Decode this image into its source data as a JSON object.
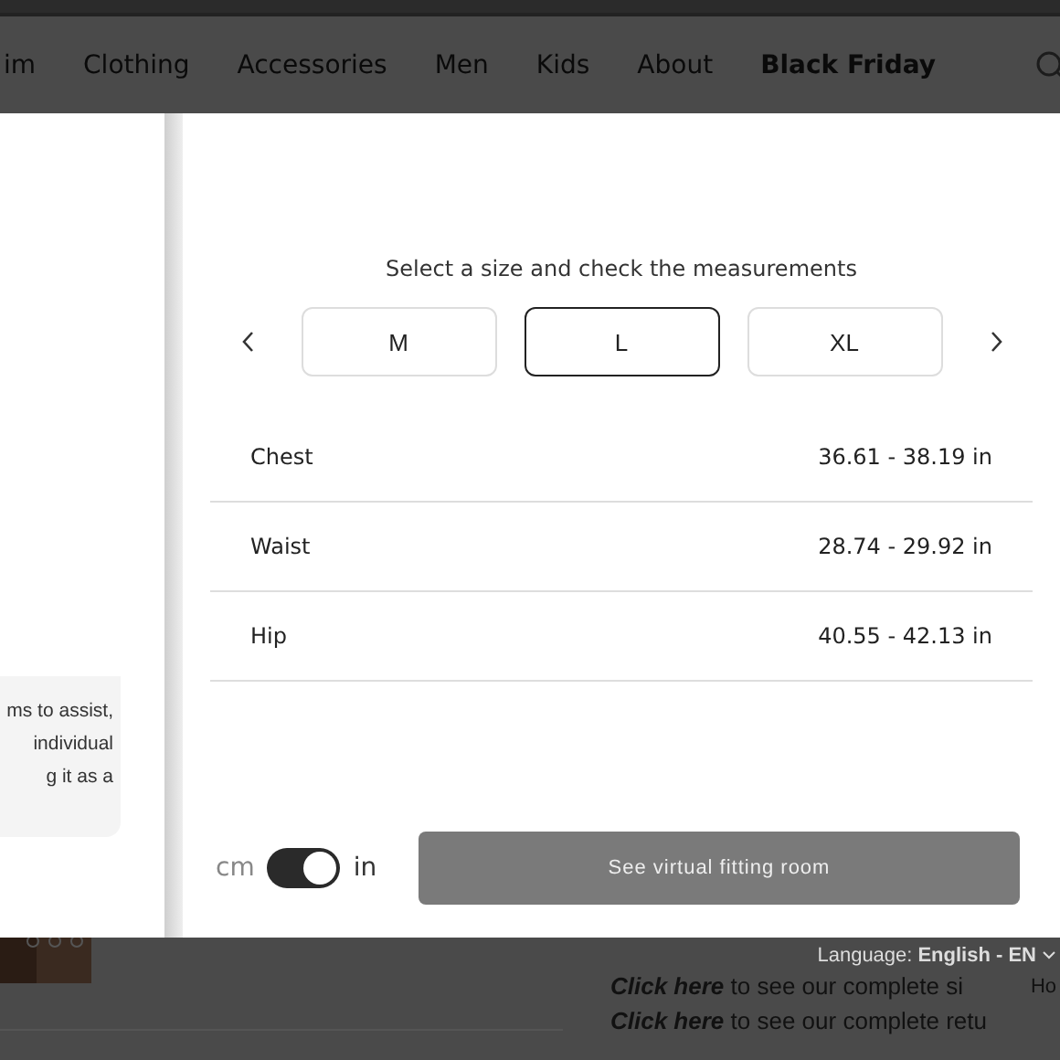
{
  "nav": {
    "items": [
      {
        "label": "im",
        "emphasized": false
      },
      {
        "label": "Clothing",
        "emphasized": false
      },
      {
        "label": "Accessories",
        "emphasized": false
      },
      {
        "label": "Men",
        "emphasized": false
      },
      {
        "label": "Kids",
        "emphasized": false
      },
      {
        "label": "About",
        "emphasized": false
      },
      {
        "label": "Black Friday",
        "emphasized": true
      }
    ]
  },
  "side_panel": {
    "lines": [
      "ms to assist,",
      "individual",
      "g it as a"
    ]
  },
  "size_guide": {
    "prompt": "Select a size and check the measurements",
    "sizes": [
      {
        "label": "M",
        "selected": false
      },
      {
        "label": "L",
        "selected": true
      },
      {
        "label": "XL",
        "selected": false
      }
    ],
    "measurements": [
      {
        "name": "Chest",
        "value": "36.61 - 38.19 in"
      },
      {
        "name": "Waist",
        "value": "28.74 - 29.92 in"
      },
      {
        "name": "Hip",
        "value": "40.55 - 42.13 in"
      }
    ],
    "units": {
      "left": "cm",
      "right": "in",
      "on": true
    },
    "button": "See virtual fitting room"
  },
  "footer": {
    "language_label": "Language:",
    "language_value": "English - EN",
    "links": [
      {
        "link": "Click here",
        "rest": "to see our complete si"
      },
      {
        "link": "Click here",
        "rest": "to see our complete retu"
      }
    ],
    "cut_text": "Ho"
  }
}
